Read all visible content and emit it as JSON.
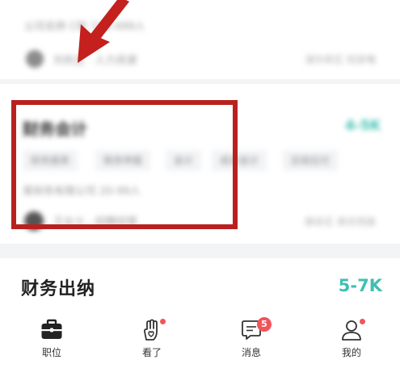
{
  "top_card": {
    "meta": "公司名称 C轮 100-499人",
    "recruiter": "刘先生 · 人力资源",
    "location": "浦东新区 陆家嘴"
  },
  "mid_card": {
    "title": "财务会计",
    "salary": "4-5K",
    "tags": [
      "财务报表",
      "税务申报",
      "会计",
      "成本会计",
      "应收应付"
    ],
    "company": "某财务有限公司 20-99人",
    "recruiter": "王女士 · 招聘经理",
    "location": "静安区 南京西路"
  },
  "job": {
    "title": "财务出纳",
    "salary": "5-7K"
  },
  "tabs": [
    {
      "label": "职位"
    },
    {
      "label": "看了"
    },
    {
      "label": "消息",
      "badge": "5"
    },
    {
      "label": "我的"
    }
  ],
  "colors": {
    "accent": "#3ec0b1",
    "highlight": "#b9211f",
    "badge": "#f2545b"
  }
}
